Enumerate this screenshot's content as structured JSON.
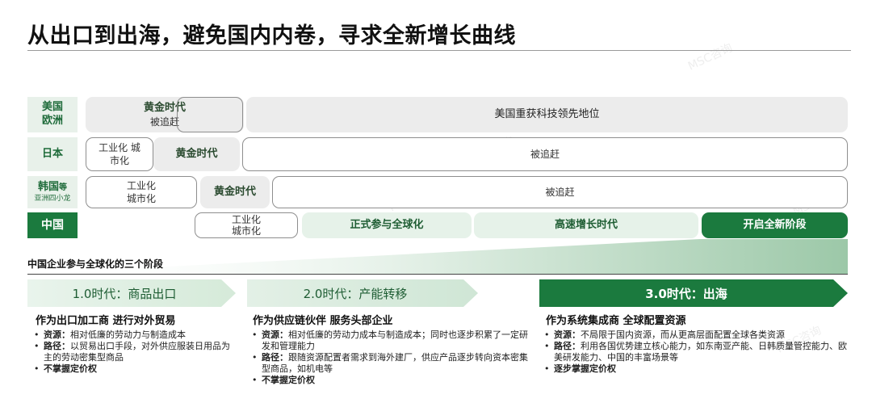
{
  "title": "从出口到出海，避免国内内卷，寻求全新增长曲线",
  "rows": {
    "us_eu": {
      "label_line1": "美国",
      "label_line2": "欧洲",
      "golden_line1": "黄金时代",
      "golden_line2": "被追赶",
      "lead": "美国重获科技领先地位"
    },
    "japan": {
      "label": "日本",
      "industrial_line1": "工业化 城",
      "industrial_line2": "市化",
      "golden": "黄金时代",
      "chased": "被追赶"
    },
    "korea": {
      "label_main": "韩国",
      "label_suffix": "等",
      "label_sub": "亚洲四小龙",
      "industrial_line1": "工业化",
      "industrial_line2": "城市化",
      "golden": "黄金时代",
      "chased": "被追赶"
    },
    "china": {
      "label": "中国",
      "industrial_line1": "工业化",
      "industrial_line2": "城市化",
      "globalization": "正式参与全球化",
      "high_growth": "高速增长时代",
      "new_stage": "开启全新阶段"
    }
  },
  "stages_title": "中国企业参与全球化的三个阶段",
  "stages": [
    {
      "chevron": "1.0时代：商品出口",
      "heading": "作为出口加工商 进行对外贸易",
      "bullets": [
        {
          "key": "资源：",
          "text": "相对低廉的劳动力与制造成本"
        },
        {
          "key": "路径：",
          "text": "以贸易出口手段，对外供应服装日用品为主的劳动密集型商品"
        },
        {
          "key": "不掌握定价权",
          "text": ""
        }
      ]
    },
    {
      "chevron": "2.0时代：产能转移",
      "heading": "作为供应链伙伴 服务头部企业",
      "bullets": [
        {
          "key": "资源：",
          "text": "相对低廉的劳动力成本与制造成本；同时也逐步积累了一定研发和管理能力"
        },
        {
          "key": "路径：",
          "text": "跟随资源配置者需求到海外建厂，供应产品逐步转向资本密集型商品，如机电等"
        },
        {
          "key": "不掌握定价权",
          "text": ""
        }
      ]
    },
    {
      "chevron": "3.0时代：出海",
      "heading": "作为系统集成商 全球配置资源",
      "bullets": [
        {
          "key": "资源：",
          "text": "不局限于国内资源，而从更高层面配置全球各类资源"
        },
        {
          "key": "路径：",
          "text": "利用各国优势建立核心能力，如东南亚产能、日韩质量管控能力、欧美研发能力、中国的丰富场景等"
        },
        {
          "key": "逐步掌握定价权",
          "text": ""
        }
      ]
    }
  ],
  "colors": {
    "dark_green": "#1b7a3e",
    "light_green": "#e6f2e9",
    "gray": "#ececec"
  },
  "watermark": "MSC咨询"
}
